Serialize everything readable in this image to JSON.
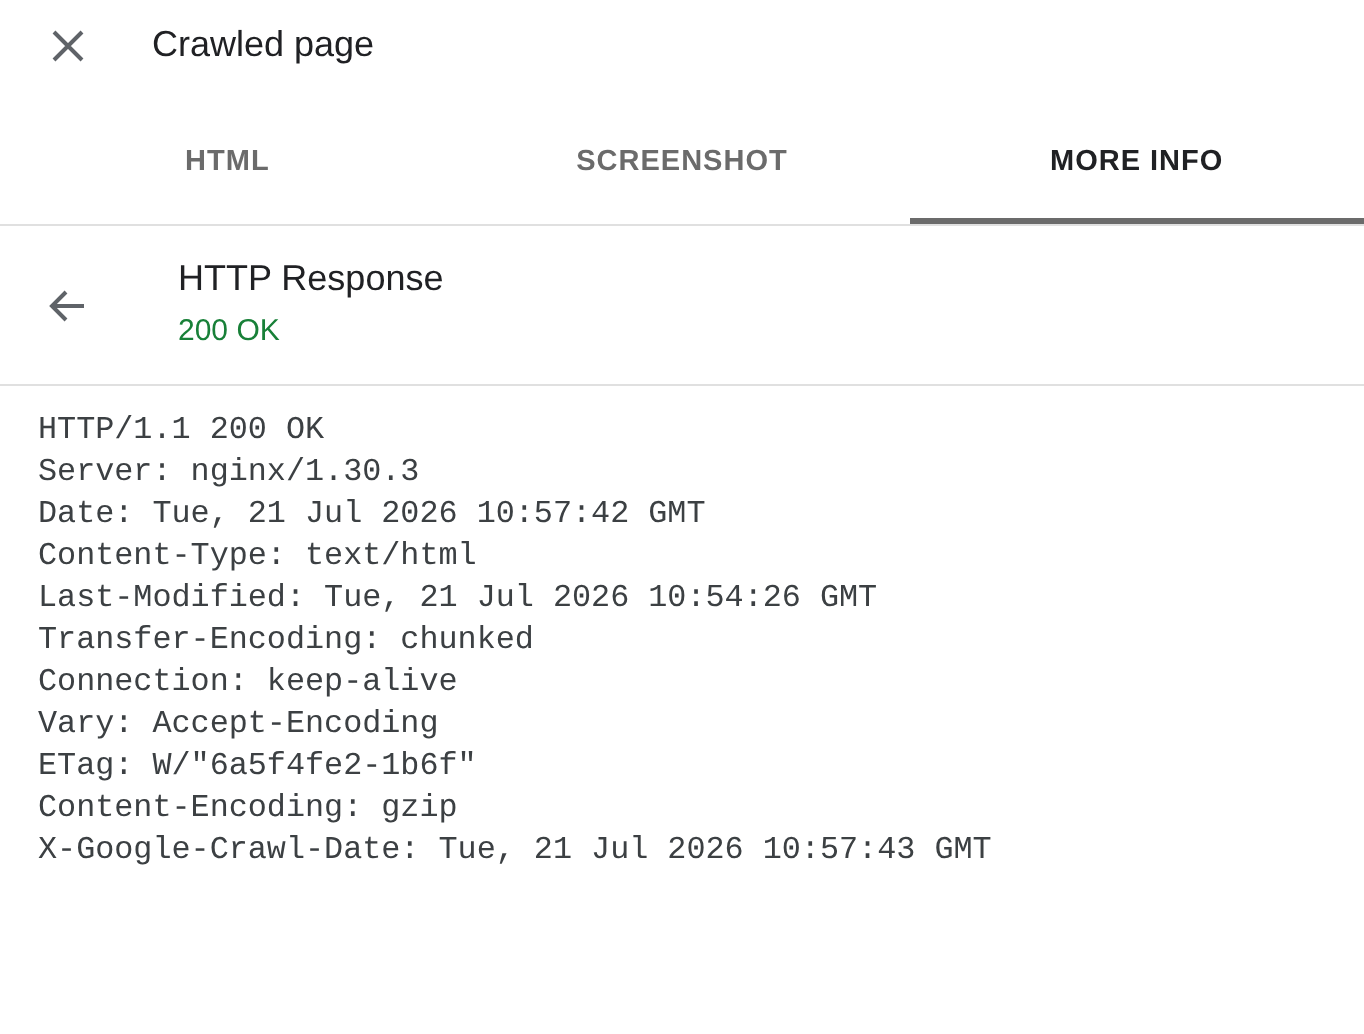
{
  "header": {
    "title": "Crawled page"
  },
  "tabs": [
    {
      "label": "HTML",
      "selected": false
    },
    {
      "label": "SCREENSHOT",
      "selected": false
    },
    {
      "label": "MORE INFO",
      "selected": true
    }
  ],
  "section": {
    "title": "HTTP Response",
    "status": "200 OK"
  },
  "response_lines": [
    "HTTP/1.1 200 OK",
    "Server: nginx/1.30.3",
    "Date: Tue, 21 Jul 2026 10:57:42 GMT",
    "Content-Type: text/html",
    "Last-Modified: Tue, 21 Jul 2026 10:54:26 GMT",
    "Transfer-Encoding: chunked",
    "Connection: keep-alive",
    "Vary: Accept-Encoding",
    "ETag: W/\"6a5f4fe2-1b6f\"",
    "Content-Encoding: gzip",
    "X-Google-Crawl-Date: Tue, 21 Jul 2026 10:57:43 GMT"
  ]
}
